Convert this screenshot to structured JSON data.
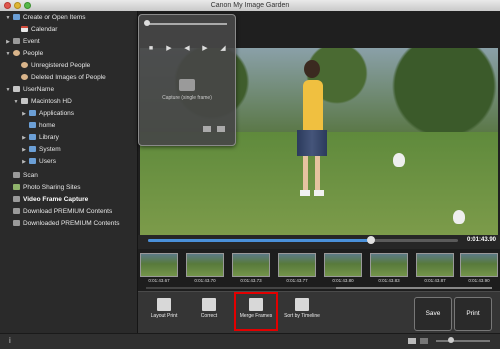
{
  "window": {
    "title": "Canon My Image Garden"
  },
  "sidebar": {
    "items": [
      {
        "label": "Create or Open Items",
        "arrow": "▼",
        "icon": "folder-icon"
      },
      {
        "label": "Calendar",
        "arrow": "",
        "icon": "calendar-icon"
      },
      {
        "label": "Event",
        "arrow": "▶",
        "icon": "event-icon"
      },
      {
        "label": "People",
        "arrow": "▼",
        "icon": "person-icon"
      },
      {
        "label": "Unregistered People",
        "arrow": "",
        "icon": "person-icon"
      },
      {
        "label": "Deleted Images of People",
        "arrow": "",
        "icon": "person-icon"
      },
      {
        "label": "UserName",
        "arrow": "▼",
        "icon": "computer-icon"
      },
      {
        "label": "Macintosh HD",
        "arrow": "▼",
        "icon": "hard-drive-icon"
      },
      {
        "label": "Applications",
        "arrow": "▶",
        "icon": "folder-icon"
      },
      {
        "label": "home",
        "arrow": "",
        "icon": "folder-icon"
      },
      {
        "label": "Library",
        "arrow": "▶",
        "icon": "folder-icon"
      },
      {
        "label": "System",
        "arrow": "▶",
        "icon": "folder-icon"
      },
      {
        "label": "Users",
        "arrow": "▶",
        "icon": "folder-icon"
      },
      {
        "label": "Scan",
        "arrow": "",
        "icon": "scan-icon"
      },
      {
        "label": "Photo Sharing Sites",
        "arrow": "",
        "icon": "globe-icon"
      },
      {
        "label": "Video Frame Capture",
        "arrow": "",
        "icon": "video-icon",
        "selected": true
      },
      {
        "label": "Download PREMIUM Contents",
        "arrow": "",
        "icon": "download-icon"
      },
      {
        "label": "Downloaded PREMIUM Contents",
        "arrow": "",
        "icon": "download-icon"
      }
    ]
  },
  "player_panel": {
    "capture_label": "Capture (single frame)"
  },
  "timeline": {
    "current_time": "0:01:43.90",
    "progress": 0.72
  },
  "filmstrip": {
    "frames": [
      "0:01:43.67",
      "0:01:43.70",
      "0:01:43.73",
      "0:01:43.77",
      "0:01:43.80",
      "0:01:43.83",
      "0:01:43.87",
      "0:01:43.90"
    ]
  },
  "actions": {
    "layout_print": "Layout Print",
    "correct": "Correct",
    "merge_frames": "Merge Frames",
    "sort_by_timeline": "Sort by Timeline",
    "save": "Save",
    "print": "Print"
  },
  "statusbar": {
    "info_icon": "info-icon",
    "info_glyph": "i"
  },
  "colors": {
    "highlight": "#e30000",
    "accent": "#4a90d9"
  }
}
